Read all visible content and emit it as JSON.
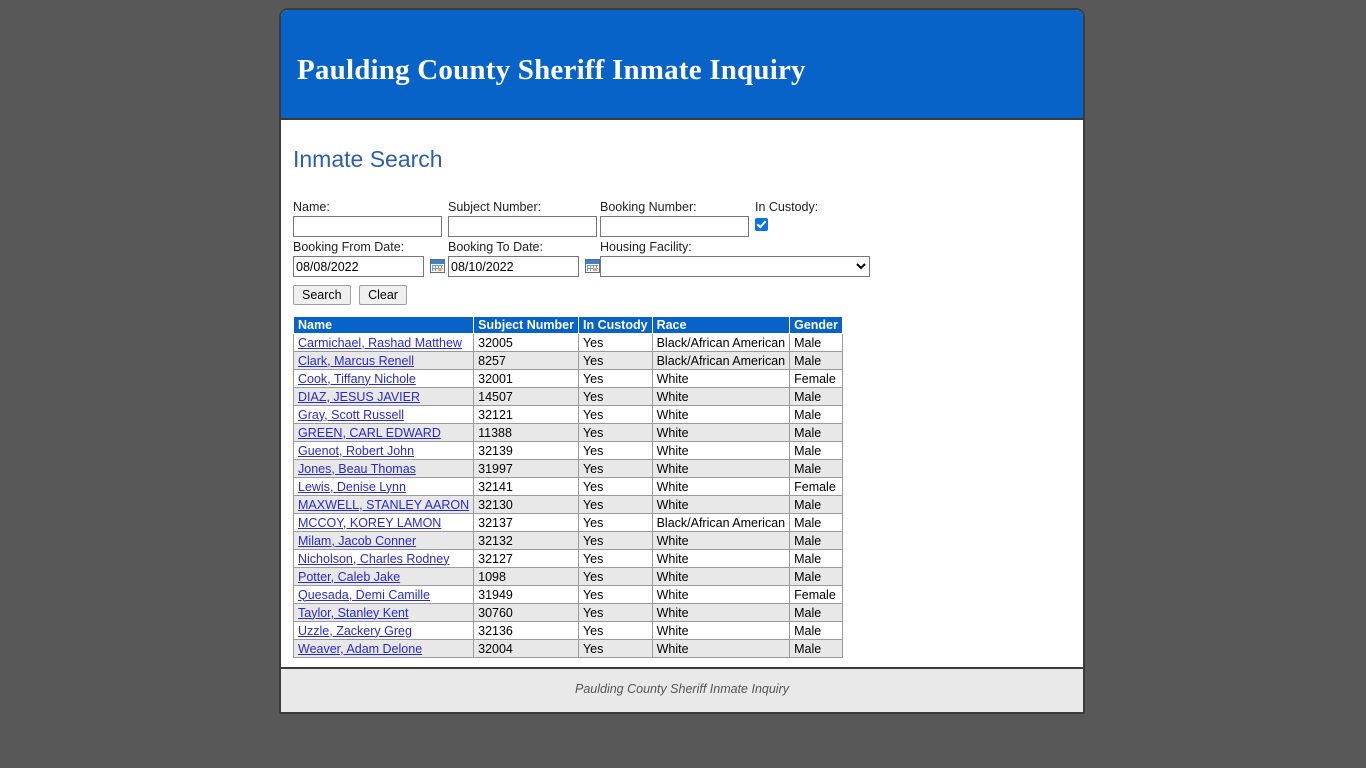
{
  "banner": {
    "title": "Paulding County Sheriff Inmate Inquiry",
    "background_color": "#0763C8"
  },
  "section": {
    "title": "Inmate Search",
    "title_color": "#2A5FAA"
  },
  "search_form": {
    "name": {
      "label": "Name:",
      "value": "",
      "placeholder": ""
    },
    "subject_number": {
      "label": "Subject Number:",
      "value": "",
      "placeholder": ""
    },
    "booking_number": {
      "label": "Booking Number:",
      "value": "",
      "placeholder": ""
    },
    "in_custody": {
      "label": "In Custody:",
      "checked": true,
      "accent_color": "#0B72E0"
    },
    "booking_from_date": {
      "label": "Booking From Date:",
      "value": "08/08/2022",
      "icon": "calendar-icon"
    },
    "booking_to_date": {
      "label": "Booking To Date:",
      "value": "08/10/2022",
      "icon": "calendar-icon"
    },
    "housing_facility": {
      "label": "Housing Facility:",
      "value": "",
      "options": [
        ""
      ],
      "icon": "chevron-down-icon"
    },
    "search_button": "Search",
    "clear_button": "Clear"
  },
  "results": {
    "columns": [
      "Name",
      "Subject Number",
      "In Custody",
      "Race",
      "Gender"
    ],
    "header_background": "#0763C8",
    "rows": [
      {
        "name": "Carmichael, Rashad Matthew",
        "subject_number": "32005",
        "in_custody": "Yes",
        "race": "Black/African American",
        "gender": "Male"
      },
      {
        "name": "Clark, Marcus Renell",
        "subject_number": "8257",
        "in_custody": "Yes",
        "race": "Black/African American",
        "gender": "Male"
      },
      {
        "name": "Cook, Tiffany Nichole",
        "subject_number": "32001",
        "in_custody": "Yes",
        "race": "White",
        "gender": "Female"
      },
      {
        "name": "DIAZ, JESUS JAVIER",
        "subject_number": "14507",
        "in_custody": "Yes",
        "race": "White",
        "gender": "Male"
      },
      {
        "name": "Gray, Scott Russell",
        "subject_number": "32121",
        "in_custody": "Yes",
        "race": "White",
        "gender": "Male"
      },
      {
        "name": "GREEN, CARL EDWARD",
        "subject_number": "11388",
        "in_custody": "Yes",
        "race": "White",
        "gender": "Male"
      },
      {
        "name": "Guenot, Robert John",
        "subject_number": "32139",
        "in_custody": "Yes",
        "race": "White",
        "gender": "Male"
      },
      {
        "name": "Jones, Beau Thomas",
        "subject_number": "31997",
        "in_custody": "Yes",
        "race": "White",
        "gender": "Male"
      },
      {
        "name": "Lewis, Denise Lynn",
        "subject_number": "32141",
        "in_custody": "Yes",
        "race": "White",
        "gender": "Female"
      },
      {
        "name": "MAXWELL, STANLEY AARON",
        "subject_number": "32130",
        "in_custody": "Yes",
        "race": "White",
        "gender": "Male"
      },
      {
        "name": "MCCOY, KOREY LAMON",
        "subject_number": "32137",
        "in_custody": "Yes",
        "race": "Black/African American",
        "gender": "Male"
      },
      {
        "name": "Milam, Jacob Conner",
        "subject_number": "32132",
        "in_custody": "Yes",
        "race": "White",
        "gender": "Male"
      },
      {
        "name": "Nicholson, Charles Rodney",
        "subject_number": "32127",
        "in_custody": "Yes",
        "race": "White",
        "gender": "Male"
      },
      {
        "name": "Potter, Caleb Jake",
        "subject_number": "1098",
        "in_custody": "Yes",
        "race": "White",
        "gender": "Male"
      },
      {
        "name": "Quesada, Demi Camille",
        "subject_number": "31949",
        "in_custody": "Yes",
        "race": "White",
        "gender": "Female"
      },
      {
        "name": "Taylor, Stanley Kent",
        "subject_number": "30760",
        "in_custody": "Yes",
        "race": "White",
        "gender": "Male"
      },
      {
        "name": "Uzzle, Zackery Greg",
        "subject_number": "32136",
        "in_custody": "Yes",
        "race": "White",
        "gender": "Male"
      },
      {
        "name": "Weaver, Adam Delone",
        "subject_number": "32004",
        "in_custody": "Yes",
        "race": "White",
        "gender": "Male"
      }
    ]
  },
  "footer": {
    "text": "Paulding County Sheriff Inmate Inquiry"
  }
}
